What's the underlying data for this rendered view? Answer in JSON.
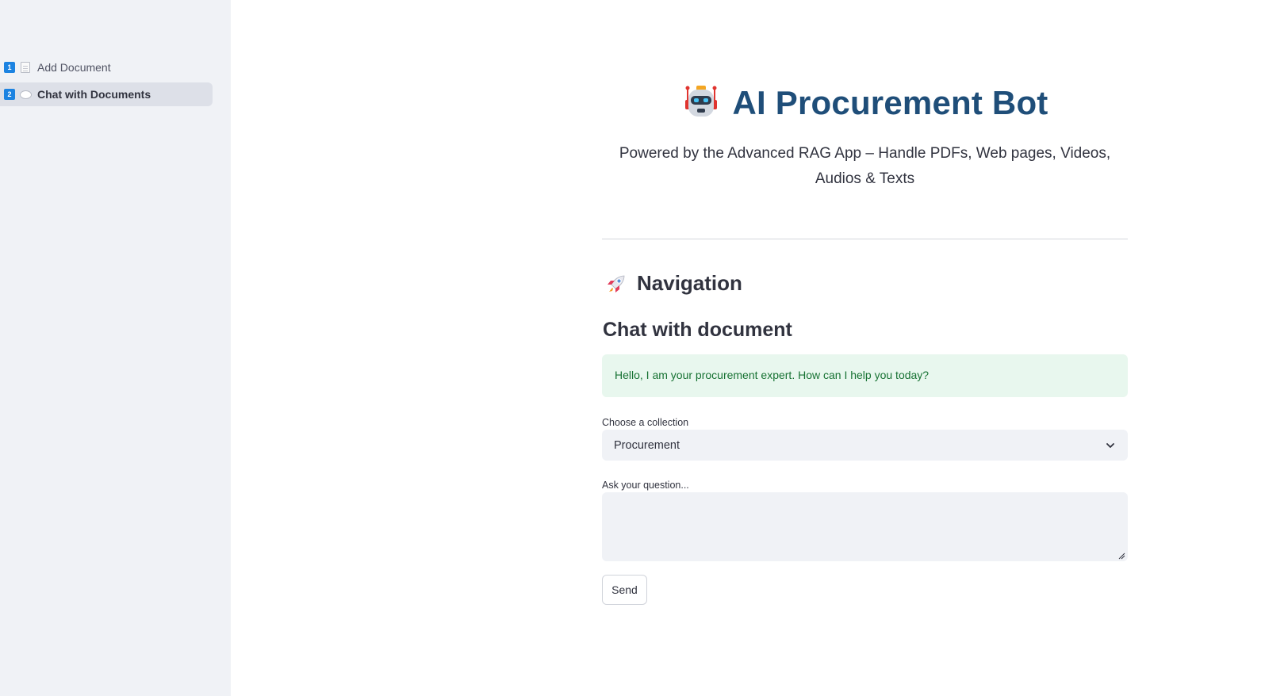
{
  "sidebar": {
    "items": [
      {
        "badge": "1",
        "icon": "document-icon",
        "label": "Add Document",
        "active": false
      },
      {
        "badge": "2",
        "icon": "speech-bubble-icon",
        "label": "Chat with Documents",
        "active": true
      }
    ]
  },
  "header": {
    "icon": "robot-icon",
    "title": "AI Procurement Bot",
    "subtitle": "Powered by the Advanced RAG App – Handle PDFs, Web pages, Videos, Audios & Texts"
  },
  "navigation": {
    "icon": "rocket-icon",
    "heading": "Navigation"
  },
  "chat": {
    "title": "Chat with document",
    "greeting": "Hello, I am your procurement expert. How can I help you today?",
    "collection_label": "Choose a collection",
    "collection_value": "Procurement",
    "question_label": "Ask your question...",
    "question_value": "",
    "send_label": "Send"
  },
  "colors": {
    "title": "#1f4e79",
    "sidebar_bg": "#f0f2f6",
    "badge": "#1c83e1",
    "alert_bg": "#e8f7ee",
    "alert_text": "#177233"
  }
}
